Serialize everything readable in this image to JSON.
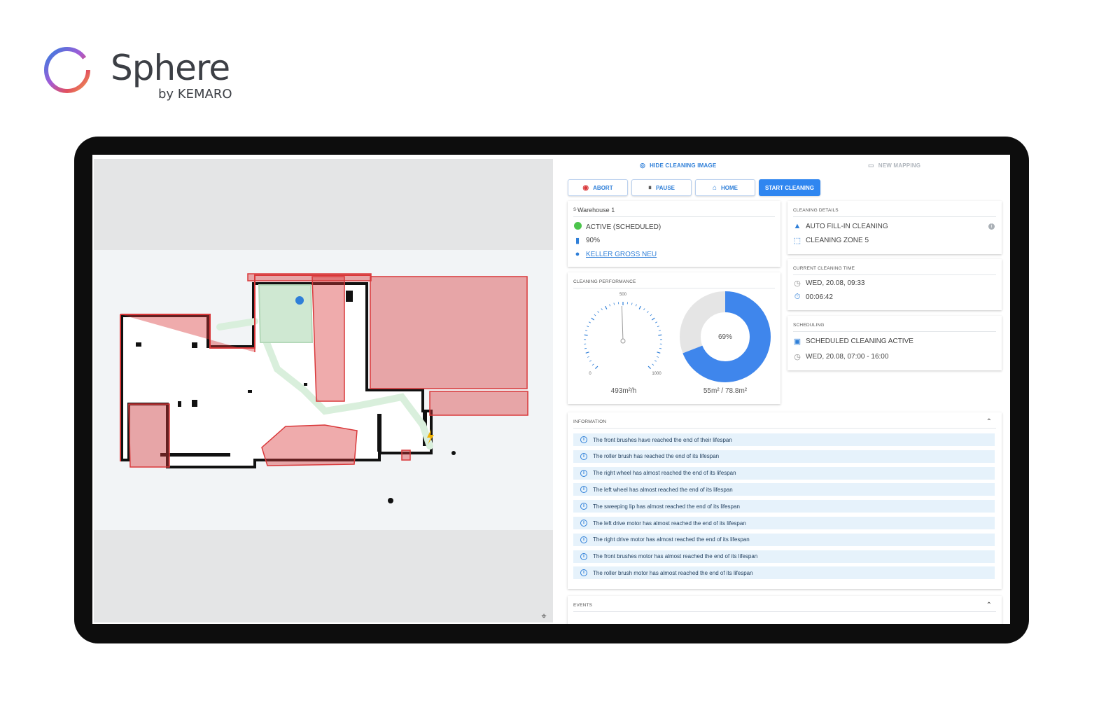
{
  "brand": {
    "name": "Sphere",
    "byline": "by KEMARO"
  },
  "top_actions": {
    "hide_image": "HIDE CLEANING IMAGE",
    "new_mapping": "NEW MAPPING"
  },
  "buttons": {
    "abort": "ABORT",
    "pause": "PAUSE",
    "home": "HOME",
    "start": "START CLEANING"
  },
  "robot": {
    "name_prefix": "S·",
    "name": "Warehouse 1",
    "status": "ACTIVE (SCHEDULED)",
    "battery": "90%",
    "location": "KELLER GROSS NEU"
  },
  "cleaning_details": {
    "title": "CLEANING DETAILS",
    "mode": "AUTO FILL-IN CLEANING",
    "zone": "CLEANING ZONE 5"
  },
  "current_time": {
    "title": "CURRENT CLEANING TIME",
    "start": "WED, 20.08, 09:33",
    "elapsed": "00:06:42"
  },
  "scheduling": {
    "title": "SCHEDULING",
    "status": "SCHEDULED CLEANING ACTIVE",
    "window": "WED, 20.08, 07:00 - 16:00"
  },
  "performance": {
    "title": "CLEANING PERFORMANCE",
    "gauge": {
      "min": "0",
      "mid": "500",
      "max": "1000",
      "value": 493,
      "range_max": 1000,
      "label": "493m²/h"
    },
    "donut": {
      "percent": 0.69,
      "center_label": "69%",
      "label": "55m² / 78.8m²"
    }
  },
  "information": {
    "title": "INFORMATION",
    "items": [
      "The front brushes have reached the end of their lifespan",
      "The roller brush has reached the end of its lifespan",
      "The right wheel has almost reached the end of its lifespan",
      "The left wheel has almost reached the end of its lifespan",
      "The sweeping lip has almost reached the end of its lifespan",
      "The left drive motor has almost reached the end of its lifespan",
      "The right drive motor has almost reached the end of its lifespan",
      "The front brushes motor has almost reached the end of its lifespan",
      "The roller brush motor has almost reached the end of its lifespan"
    ]
  },
  "events": {
    "title": "EVENTS"
  },
  "colors": {
    "accent": "#2f86f0",
    "status_ok": "#4cc44c",
    "no_go_zone": "#d9383a",
    "donut_fill": "#3f86ec",
    "donut_rest": "#e5e5e5"
  },
  "icons": {
    "hide": "crosshair-icon",
    "new_mapping": "map-icon",
    "abort": "stop-circle-icon",
    "pause": "pause-circle-icon",
    "home": "home-icon",
    "status": "status-dot-icon",
    "battery": "battery-icon",
    "location": "location-pin-icon",
    "mode": "navigation-arrow-icon",
    "zone": "dotted-square-icon",
    "info": "info-icon",
    "clock": "clock-icon",
    "timer": "timer-icon",
    "calendar": "calendar-play-icon",
    "locate": "locate-icon"
  }
}
